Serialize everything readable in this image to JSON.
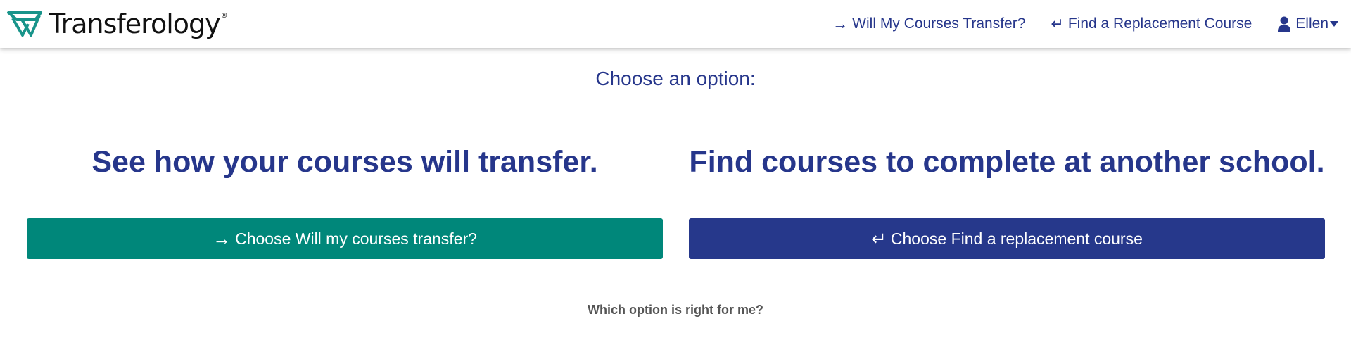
{
  "header": {
    "logo_text": "Transferology",
    "logo_registered": "®",
    "nav": {
      "will_transfer": {
        "icon": "→",
        "label": "Will My Courses Transfer?"
      },
      "find_replacement": {
        "icon": "↵",
        "label": "Find a Replacement Course"
      },
      "user": {
        "icon": "user-icon",
        "name": "Ellen"
      }
    }
  },
  "main": {
    "prompt": "Choose an option:",
    "options": [
      {
        "heading": "See how your courses will transfer.",
        "button_icon": "→",
        "button_label": "Choose Will my courses transfer?"
      },
      {
        "heading": "Find courses to complete at another school.",
        "button_icon": "↵",
        "button_label": "Choose Find a replacement course"
      }
    ],
    "help_link": "Which option is right for me?"
  },
  "colors": {
    "brand_blue": "#26368b",
    "brand_teal": "#00877a",
    "button_blue": "#26388b",
    "link_gray": "#555555"
  }
}
